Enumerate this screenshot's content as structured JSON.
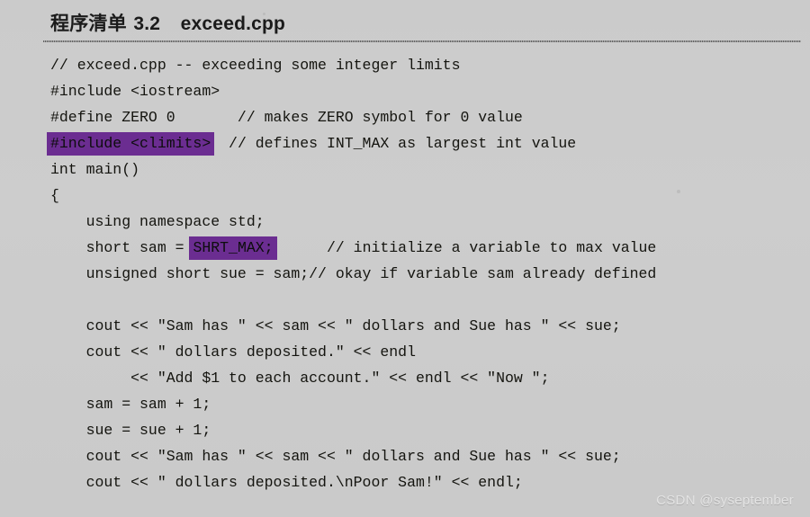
{
  "document": {
    "background_color": "#cccccc",
    "text_color": "#14140f",
    "highlight_color": "#6b2d91",
    "watermark_color": "#e3e3e3"
  },
  "header": {
    "label_cn": "程序清单",
    "number": "3.2",
    "filename": "exceed.cpp",
    "full_title": "程序清单 3.2　exceed.cpp"
  },
  "code": {
    "language": "cpp",
    "lines": [
      {
        "id": 1,
        "text": "// exceed.cpp -- exceeding some integer limits",
        "highlight": null
      },
      {
        "id": 2,
        "text": "#include <iostream>",
        "highlight": null
      },
      {
        "id": 3,
        "text": "#define ZERO 0        // makes ZERO symbol for 0 value",
        "highlight": null
      },
      {
        "id": 4,
        "text": "#include <climits>    // defines INT_MAX as largest int value",
        "highlight": "#include <climits>"
      },
      {
        "id": 5,
        "text": "int main()",
        "highlight": null
      },
      {
        "id": 6,
        "text": "{",
        "highlight": null
      },
      {
        "id": 7,
        "text": "    using namespace std;",
        "highlight": null
      },
      {
        "id": 8,
        "text": "    short sam = SHRT_MAX;      // initialize a variable to max value",
        "highlight": "SHRT_MAX;"
      },
      {
        "id": 9,
        "text": "    unsigned short sue = sam;// okay if variable sam already defined",
        "highlight": null
      },
      {
        "id": 10,
        "text": "",
        "highlight": null
      },
      {
        "id": 11,
        "text": "    cout << \"Sam has \" << sam << \" dollars and Sue has \" << sue;",
        "highlight": null
      },
      {
        "id": 12,
        "text": "    cout << \" dollars deposited.\" << endl",
        "highlight": null
      },
      {
        "id": 13,
        "text": "         << \"Add $1 to each account.\" << endl << \"Now \";",
        "highlight": null
      },
      {
        "id": 14,
        "text": "    sam = sam + 1;",
        "highlight": null
      },
      {
        "id": 15,
        "text": "    sue = sue + 1;",
        "highlight": null
      },
      {
        "id": 16,
        "text": "    cout << \"Sam has \" << sam << \" dollars and Sue has \" << sue;",
        "highlight": null
      },
      {
        "id": 17,
        "text": "    cout << \" dollars deposited.\\nPoor Sam!\" << endl;",
        "highlight": null
      }
    ],
    "line_segments": [
      {
        "id": 1,
        "parts": [
          {
            "t": "// exceed.cpp -- exceeding some integer limits",
            "h": false
          }
        ]
      },
      {
        "id": 2,
        "parts": [
          {
            "t": "#include <iostream>",
            "h": false
          }
        ]
      },
      {
        "id": 3,
        "parts": [
          {
            "t": "#define ZERO 0       // makes ZERO symbol for 0 value",
            "h": false
          }
        ]
      },
      {
        "id": 4,
        "parts": [
          {
            "t": "#include <climits>",
            "h": true
          },
          {
            "t": "  // defines INT_MAX as largest int value",
            "h": false
          }
        ]
      },
      {
        "id": 5,
        "parts": [
          {
            "t": "int main()",
            "h": false
          }
        ]
      },
      {
        "id": 6,
        "parts": [
          {
            "t": "{",
            "h": false
          }
        ]
      },
      {
        "id": 7,
        "parts": [
          {
            "t": "    using namespace std;",
            "h": false
          }
        ]
      },
      {
        "id": 8,
        "parts": [
          {
            "t": "    short sam = ",
            "h": false
          },
          {
            "t": "SHRT_MAX;",
            "h": true
          },
          {
            "t": "      // initialize a variable to max value",
            "h": false
          }
        ]
      },
      {
        "id": 9,
        "parts": [
          {
            "t": "    unsigned short sue = sam;// okay if variable sam already defined",
            "h": false
          }
        ]
      },
      {
        "id": 10,
        "parts": [
          {
            "t": "",
            "h": false
          }
        ]
      },
      {
        "id": 11,
        "parts": [
          {
            "t": "    cout << \"Sam has \" << sam << \" dollars and Sue has \" << sue;",
            "h": false
          }
        ]
      },
      {
        "id": 12,
        "parts": [
          {
            "t": "    cout << \" dollars deposited.\" << endl",
            "h": false
          }
        ]
      },
      {
        "id": 13,
        "parts": [
          {
            "t": "         << \"Add $1 to each account.\" << endl << \"Now \";",
            "h": false
          }
        ]
      },
      {
        "id": 14,
        "parts": [
          {
            "t": "    sam = sam + 1;",
            "h": false
          }
        ]
      },
      {
        "id": 15,
        "parts": [
          {
            "t": "    sue = sue + 1;",
            "h": false
          }
        ]
      },
      {
        "id": 16,
        "parts": [
          {
            "t": "    cout << \"Sam has \" << sam << \" dollars and Sue has \" << sue;",
            "h": false
          }
        ]
      },
      {
        "id": 17,
        "parts": [
          {
            "t": "    cout << \" dollars deposited.\\nPoor Sam!\" << endl;",
            "h": false
          }
        ]
      }
    ]
  },
  "watermark": {
    "text": "CSDN @syseptember"
  }
}
